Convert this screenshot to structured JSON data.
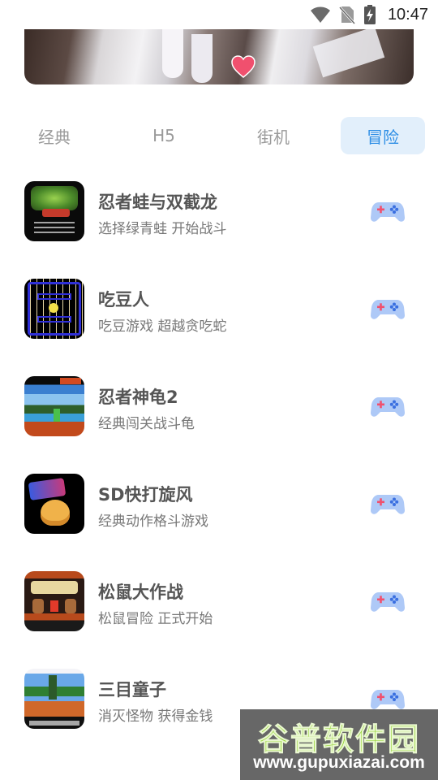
{
  "status_bar": {
    "time": "10:47",
    "icons": [
      "wifi-icon",
      "no-sim-icon",
      "battery-charging-icon"
    ]
  },
  "banner": {
    "icon": "heart-icon",
    "heart_color": "#f0506e"
  },
  "tabs": [
    {
      "label": "经典",
      "active": false
    },
    {
      "label": "H5",
      "active": false
    },
    {
      "label": "街机",
      "active": false
    },
    {
      "label": "冒险",
      "active": true
    }
  ],
  "accent_color": "#2f8fe6",
  "games": [
    {
      "title": "忍者蛙与双截龙",
      "desc": "选择绿青蛙 开始战斗",
      "action_icon": "gamepad-icon"
    },
    {
      "title": "吃豆人",
      "desc": "吃豆游戏 超越贪吃蛇",
      "action_icon": "gamepad-icon"
    },
    {
      "title": "忍者神龟2",
      "desc": "经典闯关战斗龟",
      "action_icon": "gamepad-icon"
    },
    {
      "title": "SD快打旋风",
      "desc": "经典动作格斗游戏",
      "action_icon": "gamepad-icon"
    },
    {
      "title": "松鼠大作战",
      "desc": "松鼠冒险 正式开始",
      "action_icon": "gamepad-icon"
    },
    {
      "title": "三目童子",
      "desc": "消灭怪物 获得金钱",
      "action_icon": "gamepad-icon"
    }
  ],
  "watermark": {
    "title": "谷普软件园",
    "url": "www.gupuxiazai.com"
  }
}
